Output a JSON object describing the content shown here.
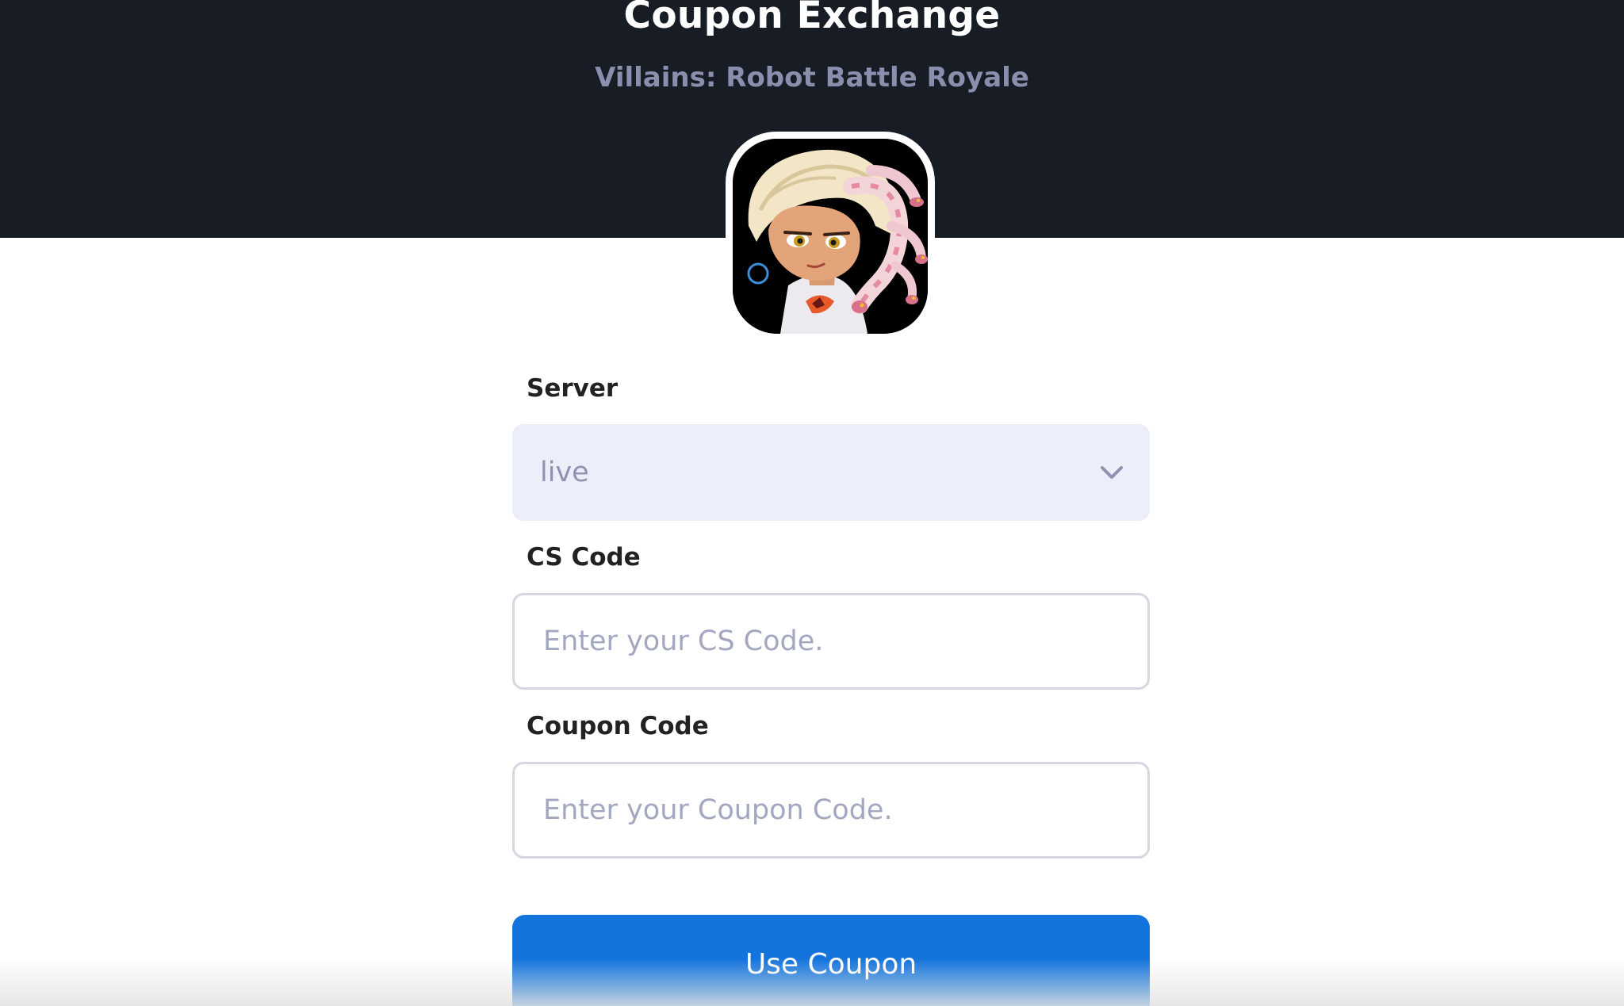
{
  "header": {
    "title": "Coupon Exchange",
    "subtitle": "Villains: Robot Battle Royale",
    "avatar_icon": "game-character-avatar"
  },
  "form": {
    "server": {
      "label": "Server",
      "selected_value": "live",
      "dropdown_icon": "chevron-down-icon"
    },
    "cs_code": {
      "label": "CS Code",
      "placeholder": "Enter your CS Code.",
      "value": ""
    },
    "coupon_code": {
      "label": "Coupon Code",
      "placeholder": "Enter your Coupon Code.",
      "value": ""
    },
    "submit_label": "Use Coupon"
  },
  "colors": {
    "header_bg": "#181c25",
    "subtitle": "#8a8fad",
    "select_bg": "#eceef9",
    "button_bg": "#1374dd"
  }
}
